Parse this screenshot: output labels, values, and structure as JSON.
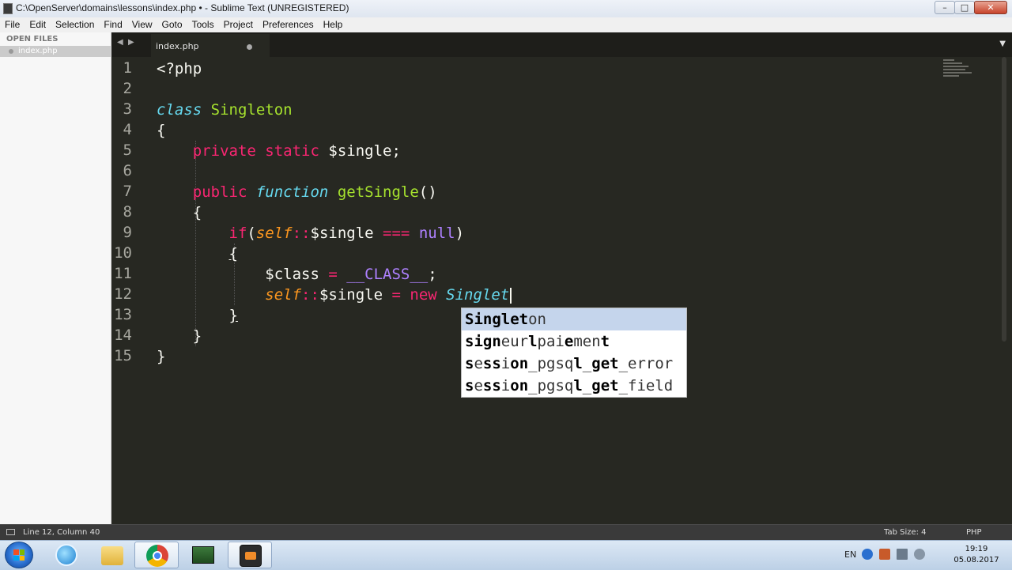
{
  "window": {
    "title": "C:\\OpenServer\\domains\\lessons\\index.php • - Sublime Text (UNREGISTERED)",
    "controls": [
      "minimize-icon",
      "maximize-icon",
      "close-icon"
    ]
  },
  "menu": {
    "items": [
      "File",
      "Edit",
      "Selection",
      "Find",
      "View",
      "Goto",
      "Tools",
      "Project",
      "Preferences",
      "Help"
    ]
  },
  "sidebar": {
    "header": "OPEN FILES",
    "files": [
      "index.php"
    ]
  },
  "tabs": {
    "nav_left": "◀",
    "nav_right": "▶",
    "items": [
      {
        "label": "index.php",
        "modified": true
      }
    ],
    "more": "▼"
  },
  "editor": {
    "line_numbers": [
      "1",
      "2",
      "3",
      "4",
      "5",
      "6",
      "7",
      "8",
      "9",
      "10",
      "11",
      "12",
      "13",
      "14",
      "15"
    ],
    "lines": [
      "<?php",
      "",
      "class Singleton",
      "{",
      "    private static $single;",
      "",
      "    public function getSingle()",
      "    {",
      "        if(self::$single === null)",
      "        {",
      "            $class = __CLASS__;",
      "            self::$single = new Singlet",
      "        }",
      "    }",
      "}"
    ],
    "code": {
      "l1": "<?php",
      "l3_kw": "class",
      "l3_name": "Singleton",
      "l4": "{",
      "l5_private": "private",
      "l5_static": "static",
      "l5_var": "$single;",
      "l7_public": "public",
      "l7_function": "function",
      "l7_name": "getSingle",
      "l7_parens": "()",
      "l8": "{",
      "l9_if": "if",
      "l9_open": "(",
      "l9_self": "self",
      "l9_colons": "::",
      "l9_var": "$single",
      "l9_op": "===",
      "l9_null": "null",
      "l9_close": ")",
      "l10": "{",
      "l11_var": "$class",
      "l11_op": "=",
      "l11_const": "__CLASS__",
      "l11_semi": ";",
      "l12_self": "self",
      "l12_colons": "::",
      "l12_var": "$single",
      "l12_op": "=",
      "l12_new": "new",
      "l12_typed": "Singlet",
      "l13": "}",
      "l14": "}",
      "l15": "}"
    }
  },
  "autocomplete": {
    "items": [
      {
        "bold": [
          "Singlet",
          ""
        ],
        "plain": [
          "on"
        ],
        "text": "Singleton",
        "selected": true
      },
      {
        "text": "signeurlpaiement",
        "selected": false
      },
      {
        "text": "session_pgsql_get_error",
        "selected": false
      },
      {
        "text": "session_pgsql_get_field",
        "selected": false
      }
    ],
    "parts": {
      "i1": [
        "Singlet",
        "on"
      ],
      "i2": [
        "sign",
        "eur",
        "l",
        "pai",
        "e",
        "men",
        "t"
      ],
      "i3": [
        "s",
        "e",
        "ss",
        "i",
        "on",
        "_pgsq",
        "l",
        "_",
        "get",
        "_error"
      ],
      "i4": [
        "s",
        "e",
        "ss",
        "i",
        "on",
        "_pgsq",
        "l",
        "_",
        "get",
        "_field"
      ]
    }
  },
  "status": {
    "position": "Line 12, Column 40",
    "tab_size": "Tab Size: 4",
    "syntax": "PHP"
  },
  "taskbar": {
    "apps": [
      "start-orb-icon",
      "network-globe-icon",
      "file-explorer-icon",
      "chrome-icon",
      "terminal-icon",
      "sublime-text-icon"
    ],
    "language": "EN",
    "time": "19:19",
    "date": "05.08.2017"
  },
  "colors": {
    "background": "#272822",
    "keyword": "#f92672",
    "storage": "#66d9ef",
    "function": "#a6e22e",
    "constant": "#ae81ff",
    "self": "#fd971f",
    "text": "#f8f8f2",
    "autocomplete_selected": "#c5d5ec"
  }
}
